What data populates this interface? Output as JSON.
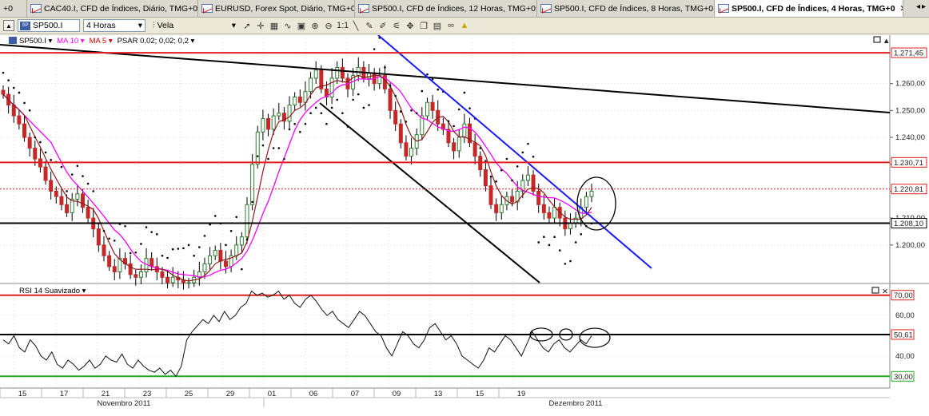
{
  "tabs": [
    {
      "label": "+0",
      "active": false
    },
    {
      "label": "CAC40.I, CFD de Índices, Diário, TMG+0",
      "active": false
    },
    {
      "label": "EURUSD, Forex Spot, Diário, TMG+0",
      "active": false
    },
    {
      "label": "SP500.I, CFD de Índices, 12 Horas, TMG+0",
      "active": false
    },
    {
      "label": "SP500.I, CFD de Índices, 8 Horas, TMG+0",
      "active": false
    },
    {
      "label": "SP500.I, CFD de Índices, 4 Horas, TMG+0",
      "active": true
    }
  ],
  "toolbar": {
    "symbol": "SP500.I",
    "timeframe": "4 Horas",
    "chart_type": "Vela",
    "zoom_label": "1:1"
  },
  "legend": {
    "symbol": "SP500.I",
    "ma10": "MA 10",
    "ma5": "MA 5",
    "psar": "PSAR 0,02; 0,02; 0,2",
    "rsi": "RSI 14 Suavizado"
  },
  "colors": {
    "up": "#2e7d32",
    "down": "#c62828",
    "ma10": "#ff00ff",
    "ma5": "#8b1a1a",
    "red_line": "#e02020",
    "blue_line": "#1a1aff",
    "green_line": "#22aa22"
  },
  "chart_data": [
    {
      "type": "candlestick",
      "title": "",
      "ylim": [
        1186,
        1278
      ],
      "y_ticks": [
        "1.260,00",
        "1.250,00",
        "1.240,00",
        "1.230,00",
        "1.220,00",
        "1.210,00",
        "1.200,00"
      ],
      "y_tick_values": [
        1260,
        1250,
        1240,
        1230,
        1220,
        1210,
        1200
      ],
      "price_labels": [
        {
          "text": "1.271,45",
          "value": 1271.45
        },
        {
          "text": "1.230,71",
          "value": 1230.71
        },
        {
          "text": "1.220,81",
          "value": 1220.81
        },
        {
          "text": "1.208,10",
          "value": 1208.1
        }
      ],
      "x_labels": [
        "15",
        "17",
        "21",
        "23",
        "25",
        "29",
        "01",
        "06",
        "07",
        "09",
        "13",
        "15",
        "19"
      ],
      "months": [
        "Novembro 2011",
        "Dezembro 2011"
      ],
      "close_series": [
        1256,
        1252,
        1248,
        1245,
        1240,
        1236,
        1232,
        1229,
        1224,
        1220,
        1218,
        1215,
        1212,
        1217,
        1219,
        1214,
        1210,
        1206,
        1200,
        1196,
        1192,
        1190,
        1195,
        1193,
        1189,
        1188,
        1190,
        1195,
        1192,
        1190,
        1188,
        1186,
        1188,
        1187,
        1186,
        1186,
        1188,
        1190,
        1193,
        1196,
        1198,
        1194,
        1192,
        1196,
        1200,
        1203,
        1215,
        1230,
        1242,
        1247,
        1243,
        1248,
        1249,
        1246,
        1252,
        1255,
        1253,
        1257,
        1262,
        1265,
        1258,
        1255,
        1262,
        1266,
        1262,
        1258,
        1263,
        1266,
        1262,
        1264,
        1260,
        1263,
        1258,
        1250,
        1245,
        1238,
        1233,
        1236,
        1241,
        1248,
        1253,
        1250,
        1245,
        1243,
        1238,
        1235,
        1240,
        1245,
        1238,
        1233,
        1228,
        1222,
        1215,
        1212,
        1215,
        1218,
        1216,
        1220,
        1224,
        1226,
        1220,
        1215,
        1212,
        1210,
        1214,
        1210,
        1206,
        1208,
        1210,
        1214,
        1218,
        1220
      ],
      "ma_series": [
        {
          "name": "MA 10"
        },
        {
          "name": "MA 5"
        }
      ],
      "horizontal_lines": [
        {
          "value": 1271.45,
          "style": "solid",
          "color": "red"
        },
        {
          "value": 1230.71,
          "style": "solid",
          "color": "red"
        },
        {
          "value": 1220.81,
          "style": "dotted",
          "color": "red"
        },
        {
          "value": 1208.1,
          "style": "solid",
          "color": "black"
        }
      ]
    },
    {
      "type": "line",
      "title": "RSI 14 Suavizado",
      "ylim": [
        25,
        75
      ],
      "y_ticks": [
        "60,00",
        "40,00"
      ],
      "y_tick_values": [
        60,
        40
      ],
      "levels": [
        {
          "text": "70,00",
          "value": 70
        },
        {
          "text": "50,61",
          "value": 50.61
        },
        {
          "text": "30,00",
          "value": 30
        }
      ],
      "rsi_series": [
        48,
        46,
        50,
        44,
        42,
        48,
        45,
        40,
        38,
        42,
        36,
        34,
        38,
        36,
        33,
        35,
        38,
        34,
        36,
        40,
        38,
        37,
        41,
        36,
        34,
        38,
        35,
        33,
        32,
        34,
        31,
        33,
        30,
        35,
        48,
        52,
        55,
        58,
        56,
        60,
        57,
        62,
        58,
        60,
        64,
        66,
        72,
        70,
        71,
        69,
        70,
        72,
        68,
        70,
        66,
        64,
        68,
        70,
        67,
        63,
        60,
        62,
        58,
        56,
        54,
        58,
        62,
        60,
        56,
        52,
        50,
        44,
        40,
        46,
        52,
        50,
        46,
        44,
        48,
        54,
        56,
        52,
        48,
        50,
        46,
        40,
        38,
        36,
        34,
        38,
        44,
        42,
        46,
        50,
        48,
        44,
        40,
        46,
        52,
        48,
        44,
        42,
        46,
        48,
        44,
        42,
        45,
        48,
        46,
        50
      ]
    }
  ]
}
